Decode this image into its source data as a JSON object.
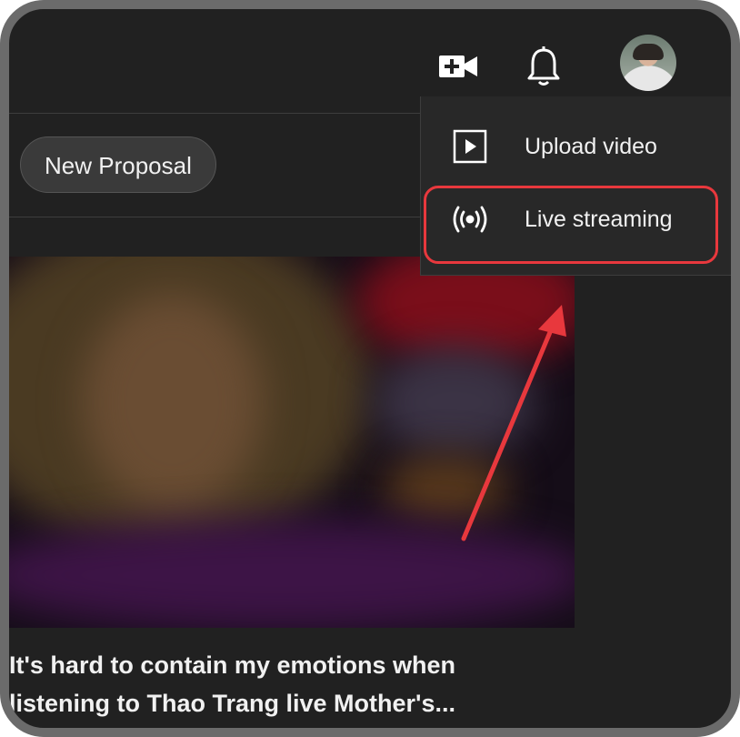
{
  "header": {
    "create_icon": "video-camera-plus-icon",
    "notifications_icon": "bell-icon",
    "avatar": "user-avatar"
  },
  "toolbar": {
    "new_proposal_label": "New Proposal"
  },
  "create_menu": {
    "items": [
      {
        "icon": "upload-play-icon",
        "label": "Upload video"
      },
      {
        "icon": "live-broadcast-icon",
        "label": "Live streaming"
      }
    ],
    "highlighted_item": "Live streaming"
  },
  "video": {
    "title": "It's hard to contain my emotions when listening to Thao Trang live Mother's..."
  },
  "colors": {
    "background": "#212121",
    "menu_background": "#282828",
    "highlight": "#e8383d",
    "text": "#f1f1f1"
  }
}
